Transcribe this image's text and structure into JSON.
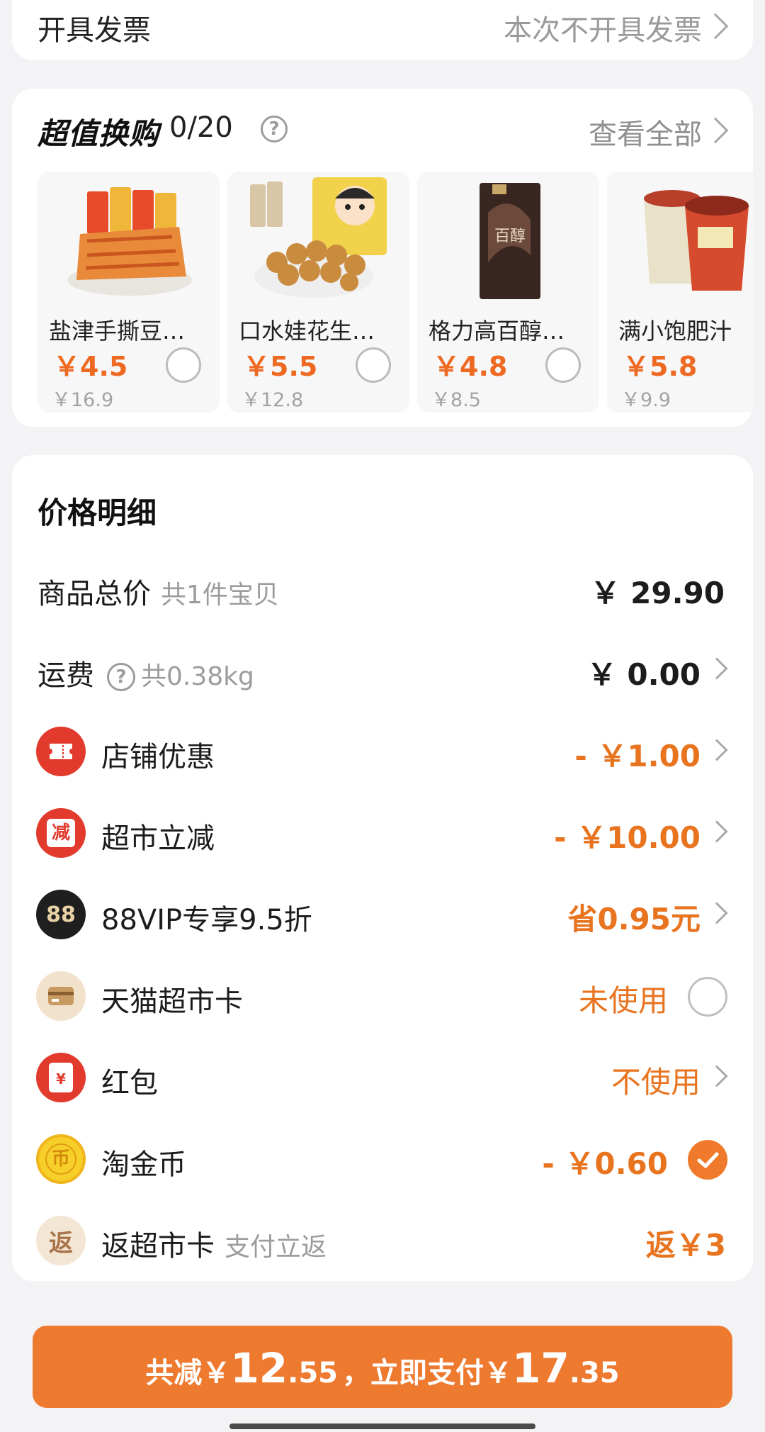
{
  "invoice": {
    "label": "开具发票",
    "value": "本次不开具发票"
  },
  "exchange": {
    "title": "超值换购",
    "count": "0/20",
    "help": "?",
    "view_all": "查看全部",
    "products": [
      {
        "name": "盐津手撕豆…",
        "price": "￥4.5",
        "original_price": "￥16.9"
      },
      {
        "name": "口水娃花生…",
        "price": "￥5.5",
        "original_price": "￥12.8"
      },
      {
        "name": "格力高百醇…",
        "price": "￥4.8",
        "original_price": "￥8.5"
      },
      {
        "name": "满小饱肥汁",
        "price": "￥5.8",
        "original_price": "￥9.9"
      }
    ]
  },
  "price_detail": {
    "title": "价格明细",
    "rows": [
      {
        "label": "商品总价",
        "sub": "共1件宝贝",
        "value": "￥ 29.90"
      },
      {
        "label": "运费",
        "sub": "共0.38kg",
        "value": "￥ 0.00"
      },
      {
        "label": "店铺优惠",
        "value": "- ￥1.00"
      },
      {
        "label": "超市立减",
        "icon_text": "减",
        "value": "- ￥10.00"
      },
      {
        "label": "88VIP专享9.5折",
        "icon_text": "88",
        "value": "省0.95元"
      },
      {
        "label": "天猫超市卡",
        "value": "未使用"
      },
      {
        "label": "红包",
        "icon_text": "¥",
        "value": "不使用"
      },
      {
        "label": "淘金币",
        "icon_text": "币",
        "value": "- ￥0.60"
      },
      {
        "label": "返超市卡",
        "sub": "支付立返",
        "icon_text": "返",
        "value": "返￥3"
      }
    ]
  },
  "pay": {
    "prefix": "共减",
    "currency": "￥",
    "discount_int": "12",
    "discount_dec": ".55",
    "middle": "，立即支付",
    "total_int": "17",
    "total_dec": ".35"
  },
  "colors": {
    "accent": "#ee7a30",
    "price_orange": "#ee6a22",
    "red_icon": "#e23b2e"
  }
}
